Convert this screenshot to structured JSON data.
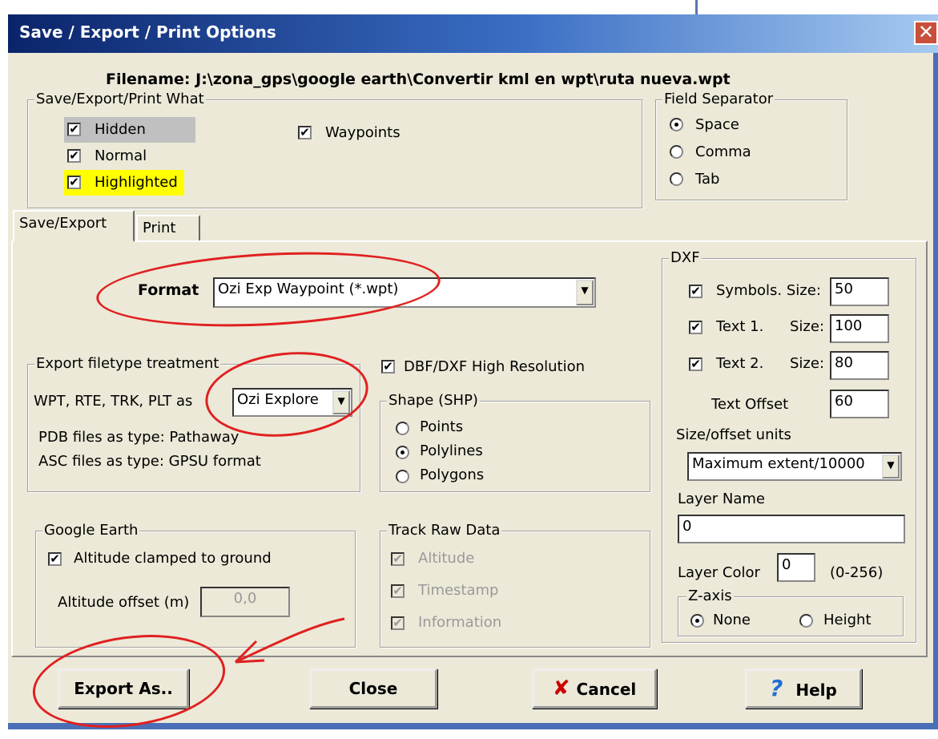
{
  "dialog": {
    "title": "Save / Export / Print Options",
    "close_glyph": "✕",
    "filename": "Filename: J:\\zona_gps\\google earth\\Convertir kml en wpt\\ruta nueva.wpt"
  },
  "save_what": {
    "legend": "Save/Export/Print What",
    "items": [
      {
        "label": "Hidden",
        "checked": true
      },
      {
        "label": "Normal",
        "checked": true
      },
      {
        "label": "Highlighted",
        "checked": true
      },
      {
        "label": "Waypoints",
        "checked": true
      }
    ]
  },
  "field_separator": {
    "legend": "Field Separator",
    "options": [
      "Space",
      "Comma",
      "Tab"
    ],
    "selected": "Space"
  },
  "tabs": [
    "Save/Export",
    "Print"
  ],
  "format": {
    "label": "Format",
    "value": "Ozi Exp  Waypoint (*.wpt)"
  },
  "export_treatment": {
    "legend": "Export filetype treatment",
    "wpt_label": "WPT, RTE, TRK, PLT as",
    "wpt_value": "Ozi Explore",
    "pdb_text": "PDB files as type: Pathaway",
    "asc_text": "ASC files as type: GPSU format"
  },
  "dbf_high_res": {
    "label": "DBF/DXF High Resolution",
    "checked": true
  },
  "shape": {
    "legend": "Shape (SHP)",
    "options": [
      "Points",
      "Polylines",
      "Polygons"
    ],
    "selected": "Polylines"
  },
  "google_earth": {
    "legend": "Google Earth",
    "clamped_label": "Altitude clamped to ground",
    "clamped_checked": true,
    "offset_label": "Altitude offset (m)",
    "offset_value": "0,0"
  },
  "track_raw": {
    "legend": "Track Raw Data",
    "items": [
      "Altitude",
      "Timestamp",
      "Information"
    ]
  },
  "dxf": {
    "legend": "DXF",
    "symbols_label": "Symbols. Size:",
    "symbols_value": "50",
    "text1_label": "Text 1.",
    "text1_size_label": "Size:",
    "text1_value": "100",
    "text2_label": "Text 2.",
    "text2_size_label": "Size:",
    "text2_value": "80",
    "text_offset_label": "Text Offset",
    "text_offset_value": "60",
    "units_label": "Size/offset units",
    "units_value": "Maximum extent/10000",
    "layer_name_label": "Layer Name",
    "layer_name_value": "0",
    "layer_color_label": "Layer Color",
    "layer_color_value": "0",
    "layer_color_range": "(0-256)",
    "zaxis_legend": "Z-axis",
    "zaxis_options": [
      "None",
      "Height"
    ],
    "zaxis_selected": "None"
  },
  "buttons": {
    "export": "Export As..",
    "close": "Close",
    "cancel": "Cancel",
    "help": "Help"
  },
  "colors": {
    "hidden_bg": "#c0c0c0",
    "highlighted_bg": "#ffff00",
    "annotation_red": "#e02020",
    "title_bar": "#0a246a"
  },
  "icons": {
    "cancel": "x-mark-icon",
    "help": "question-mark-icon"
  }
}
